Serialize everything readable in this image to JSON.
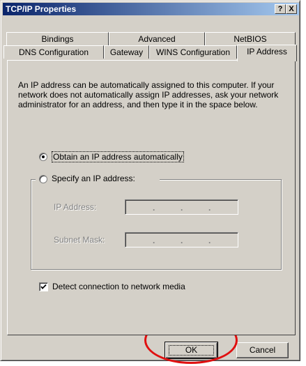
{
  "window": {
    "title": "TCP/IP Properties",
    "help_label": "?",
    "close_label": "X"
  },
  "tabs_back": [
    "Bindings",
    "Advanced",
    "NetBIOS"
  ],
  "tabs_front": [
    "DNS Configuration",
    "Gateway",
    "WINS Configuration",
    "IP Address"
  ],
  "description": "An IP address can be automatically assigned to this computer. If your network does not automatically assign IP addresses, ask your network administrator for an address, and then type it in the space below.",
  "options": {
    "obtain_label": "Obtain an IP address automatically",
    "specify_label": "Specify an IP address:",
    "selected": "obtain"
  },
  "fields": {
    "ip_label": "IP Address:",
    "subnet_label": "Subnet Mask:"
  },
  "detect": {
    "label": "Detect connection to network media",
    "checked": true
  },
  "buttons": {
    "ok": "OK",
    "cancel": "Cancel"
  },
  "annotation_color": "#e01010"
}
